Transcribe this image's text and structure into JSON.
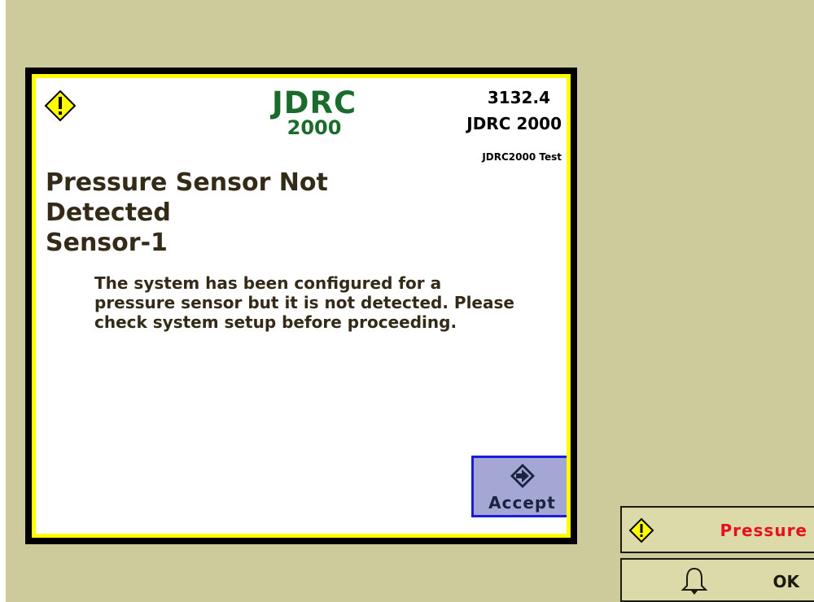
{
  "dialog": {
    "brand": {
      "line1": "JDRC",
      "line2": "2000"
    },
    "alarm_code": "3132.4",
    "model": "JDRC 2000",
    "test_label": "JDRC2000 Test",
    "title_lines": [
      "Pressure Sensor Not",
      "Detected",
      "Sensor-1"
    ],
    "message_lines": [
      "The system has been configured for a",
      "pressure sensor but it is not detected. Please",
      "check system setup before proceeding."
    ],
    "accept_label": "Accept",
    "warning_icon": "warning-icon"
  },
  "alarm_tiles": {
    "pressure_label": "Pressure",
    "ok_label": "OK"
  },
  "colors": {
    "background": "#cdcb9c",
    "frame_border": "#ffff00",
    "brand_green": "#1a6b2c",
    "accept_fill": "#a4a6d4",
    "accept_border": "#1b1bd9",
    "alarm_red": "#e8101a"
  }
}
